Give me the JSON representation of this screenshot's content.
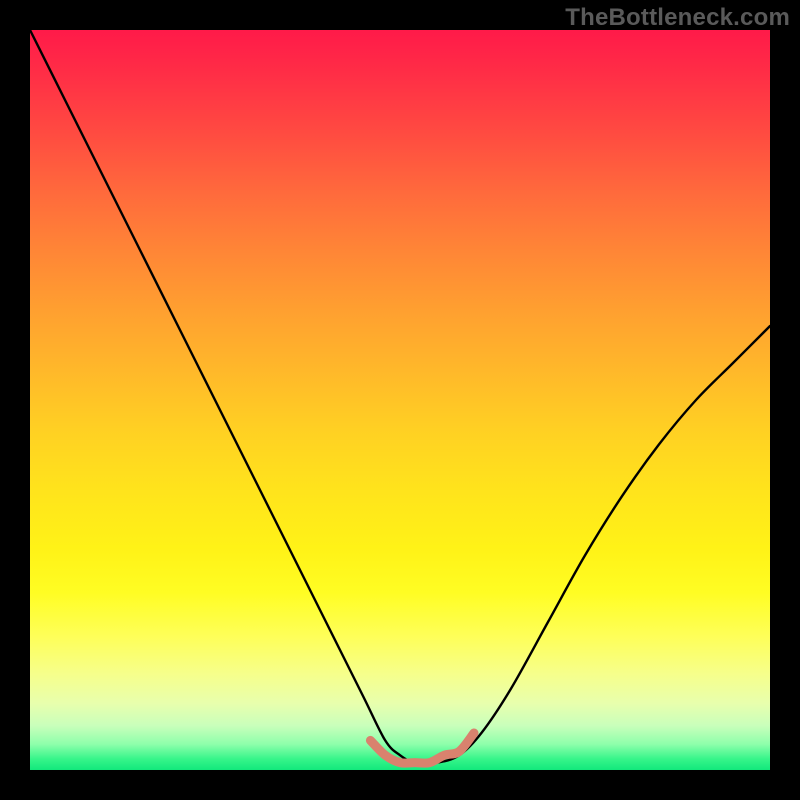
{
  "watermark": "TheBottleneck.com",
  "chart_data": {
    "type": "line",
    "title": "",
    "xlabel": "",
    "ylabel": "",
    "xlim": [
      0,
      100
    ],
    "ylim": [
      0,
      100
    ],
    "series": [
      {
        "name": "main-curve",
        "color": "#000000",
        "x": [
          0,
          5,
          10,
          15,
          20,
          25,
          30,
          35,
          40,
          45,
          48,
          50,
          52,
          55,
          58,
          61,
          65,
          70,
          75,
          80,
          85,
          90,
          95,
          100
        ],
        "y": [
          100,
          90,
          80,
          70,
          60,
          50,
          40,
          30,
          20,
          10,
          4,
          2,
          1,
          1,
          2,
          5,
          11,
          20,
          29,
          37,
          44,
          50,
          55,
          60
        ]
      },
      {
        "name": "notch-marker",
        "color": "#d9826e",
        "x": [
          46,
          48,
          50,
          52,
          54,
          56,
          58,
          60
        ],
        "y": [
          4,
          2,
          1,
          1,
          1,
          2,
          2.5,
          5
        ]
      }
    ],
    "gradient_stops": [
      {
        "pos": 0.0,
        "color": "#ff1a49"
      },
      {
        "pos": 0.5,
        "color": "#ffcc22"
      },
      {
        "pos": 0.8,
        "color": "#feff59"
      },
      {
        "pos": 0.95,
        "color": "#8effab"
      },
      {
        "pos": 1.0,
        "color": "#12e87c"
      }
    ]
  }
}
